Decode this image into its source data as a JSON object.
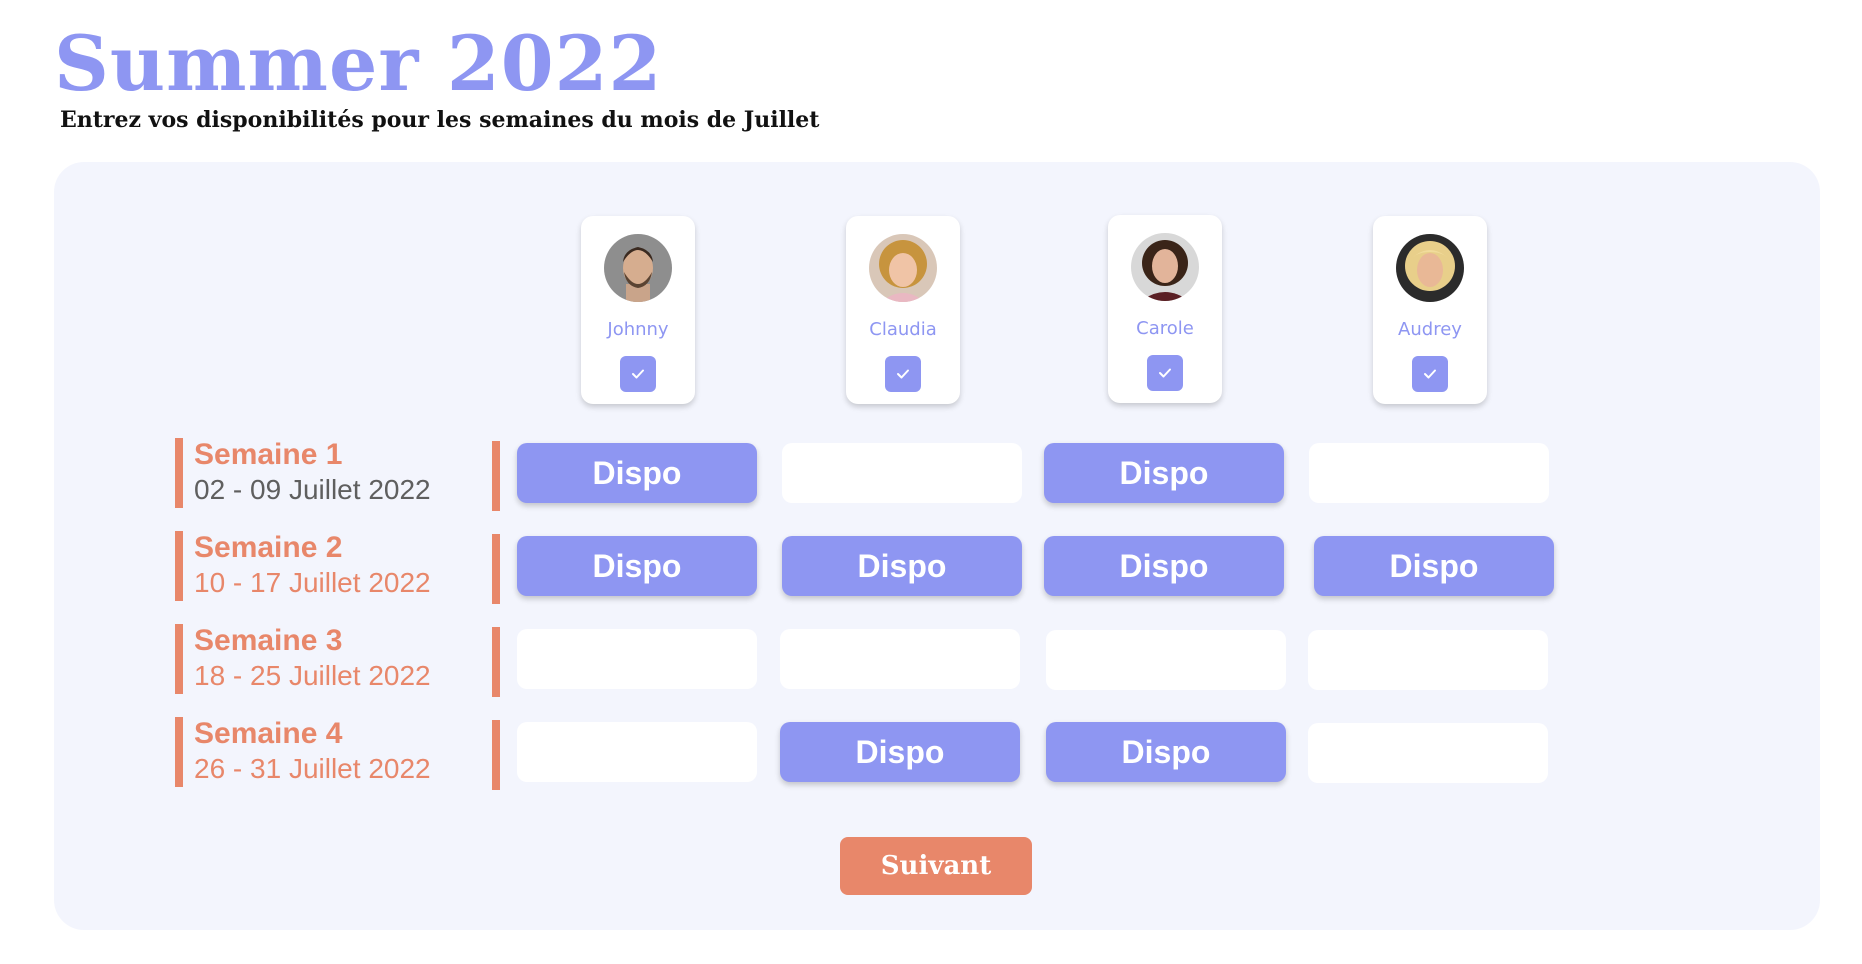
{
  "header": {
    "title": "Summer 2022",
    "subtitle": "Entrez vos disponibilités pour les semaines du mois de Juillet"
  },
  "colors": {
    "accent": "#8e96f2",
    "coral": "#e8876a",
    "panel_bg": "#f3f5fd",
    "range_grey": "#5f5f5f"
  },
  "people": [
    {
      "name": "Johnny",
      "checked": true
    },
    {
      "name": "Claudia",
      "checked": true
    },
    {
      "name": "Carole",
      "checked": true
    },
    {
      "name": "Audrey",
      "checked": true
    }
  ],
  "weeks": [
    {
      "title": "Semaine 1",
      "range": "02 - 09 Juillet 2022",
      "availability": [
        true,
        false,
        true,
        false
      ]
    },
    {
      "title": "Semaine 2",
      "range": "10 - 17 Juillet 2022",
      "availability": [
        true,
        true,
        true,
        true
      ]
    },
    {
      "title": "Semaine 3",
      "range": "18 - 25 Juillet 2022",
      "availability": [
        false,
        false,
        false,
        false
      ]
    },
    {
      "title": "Semaine 4",
      "range": "26 - 31 Juillet 2022",
      "availability": [
        false,
        true,
        true,
        false
      ]
    }
  ],
  "dispo_label": "Dispo",
  "next_button": "Suivant"
}
